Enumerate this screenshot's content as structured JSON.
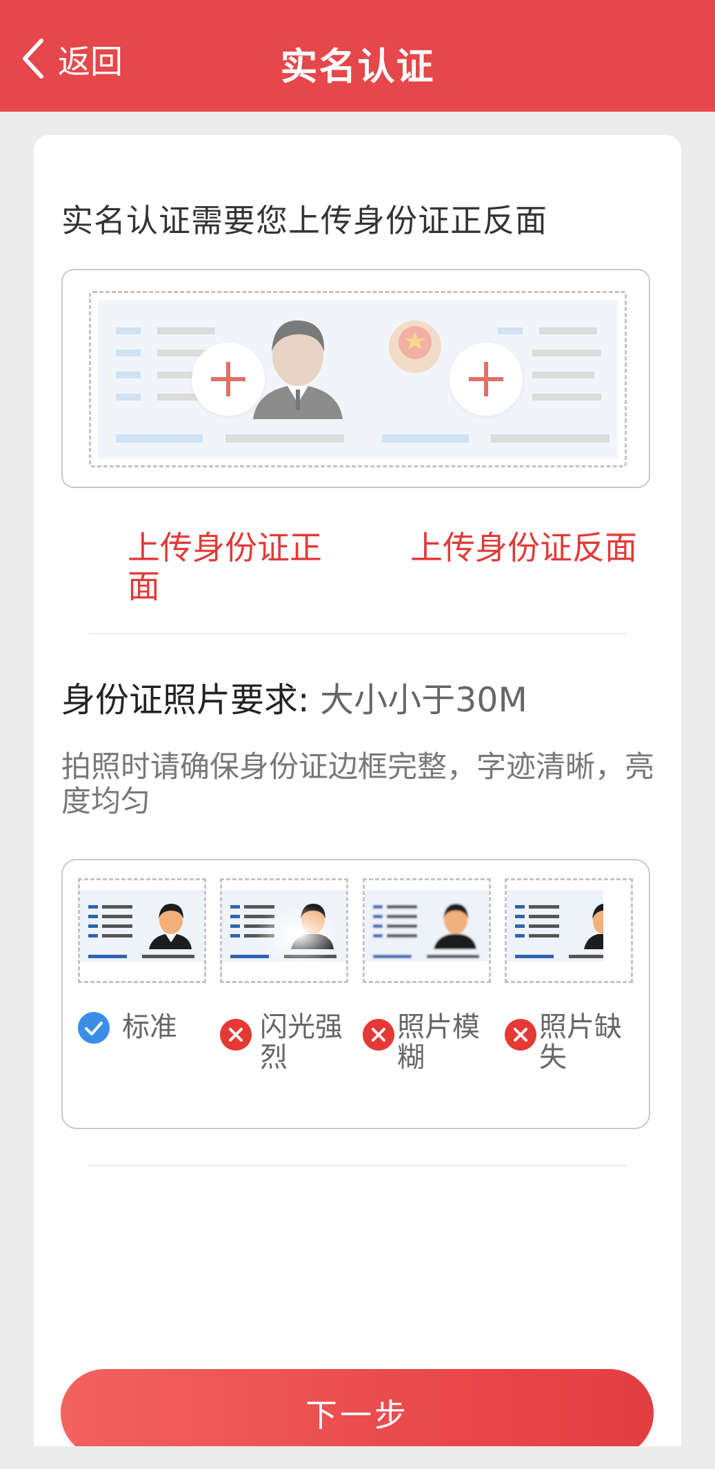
{
  "header": {
    "back_label": "返回",
    "title": "实名认证"
  },
  "intro": "实名认证需要您上传身份证正反面",
  "upload": {
    "front_label": "上传身份证正面",
    "back_label": "上传身份证反面"
  },
  "requirements": {
    "title": "身份证照片要求:",
    "size_value": "大小小于30M",
    "description": "拍照时请确保身份证边框完整，字迹清晰，亮度均匀"
  },
  "samples": [
    {
      "label": "标准",
      "status": "ok"
    },
    {
      "label": "闪光强烈",
      "status": "bad"
    },
    {
      "label": "照片模糊",
      "status": "bad"
    },
    {
      "label": "照片缺失",
      "status": "bad"
    }
  ],
  "next_button": "下一步",
  "colors": {
    "header": "#e5474a",
    "accent_red": "#e13a3a",
    "ok_blue": "#3a8ee6",
    "bad_red": "#e53935"
  }
}
